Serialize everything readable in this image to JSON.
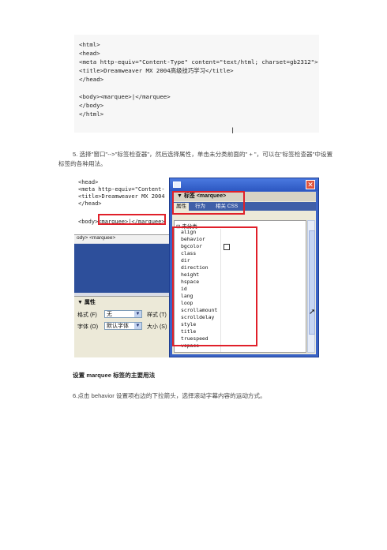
{
  "code_block": {
    "lines": [
      "<html>",
      "<head>",
      "<meta http-equiv=\"Content-Type\" content=\"text/html; charset=gb2312\">",
      "<title>Dreamweaver MX 2004高级技巧学习</title>",
      "</head>",
      "",
      "<body><marquee>|</marquee>",
      "</body>",
      "</html>"
    ],
    "cursor": "I"
  },
  "step5": {
    "line1": "5. 选择\"窗口\"-->\"标签检查器\"，然后选择属性，单击未分类前面的\" + \"，可以在\"标签检查器\"中设置",
    "line2": "标签的各种用法。"
  },
  "editor": {
    "lines": [
      "<head>",
      "<meta http-equiv=\"Content-",
      "<title>Dreamweaver MX 2004",
      "</head>",
      "",
      "<body><marquee>|</marquee>"
    ],
    "tag_path": "ody> <marquee>"
  },
  "properties": {
    "header": "▼ 属性",
    "format_label": "格式 (F)",
    "format_value": "无",
    "style_label": "样式 (T)",
    "font_label": "字体 (O)",
    "font_value": "默认字体",
    "size_label": "大小 (S)"
  },
  "inspector": {
    "panel_title": "▼ 标签 <marquee>",
    "tabs": [
      "属性",
      "行为",
      "相关 CSS"
    ],
    "category": "⊟ 未分类",
    "attributes": [
      "align",
      "behavior",
      "bgcolor",
      "class",
      "dir",
      "direction",
      "height",
      "hspace",
      "id",
      "lang",
      "loop",
      "scrollamount",
      "scrolldelay",
      "style",
      "title",
      "truespeed",
      "vspace"
    ]
  },
  "caption": {
    "prefix": "设置 ",
    "tag": "marquee",
    "suffix": " 标签的主要用法"
  },
  "step6": "6.点击 behavior 设置项右边的下拉箭头，选择滚动字幕内容的运动方式。",
  "colors": {
    "highlight": "#e0202a",
    "window_blue": "#3a63c6"
  }
}
